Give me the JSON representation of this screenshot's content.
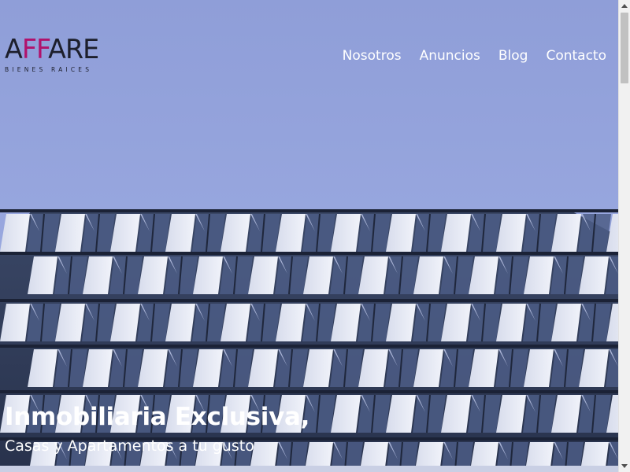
{
  "brand": {
    "logo_lead": "A",
    "logo_accent": "FF",
    "logo_tail": "ARE",
    "tagline": "BIENES RAICES",
    "accent_color": "#b0126c"
  },
  "nav": {
    "items": [
      {
        "label": "Nosotros"
      },
      {
        "label": "Anuncios"
      },
      {
        "label": "Blog"
      },
      {
        "label": "Contacto"
      }
    ]
  },
  "hero": {
    "title": "Inmobiliaria Exclusiva,",
    "subtitle": "Casas y Apartamentos a tu gusto",
    "image": "modern-building-facade"
  }
}
